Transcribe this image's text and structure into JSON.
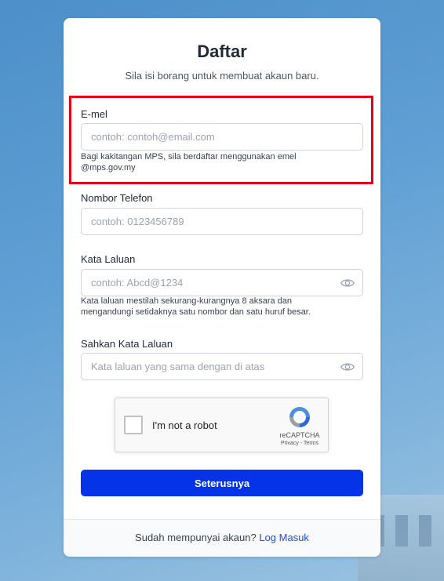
{
  "form": {
    "title": "Daftar",
    "subtitle": "Sila isi borang untuk membuat akaun baru.",
    "email": {
      "label": "E-mel",
      "placeholder": "contoh: contoh@email.com",
      "hint": "Bagi kakitangan MPS, sila berdaftar menggunakan emel @mps.gov.my"
    },
    "phone": {
      "label": "Nombor Telefon",
      "placeholder": "contoh: 0123456789"
    },
    "password": {
      "label": "Kata Laluan",
      "placeholder": "contoh: Abcd@1234",
      "hint": "Kata laluan mestilah sekurang-kurangnya 8 aksara dan mengandungi setidaknya satu nombor dan satu huruf besar.",
      "toggle_icon": "eye-icon"
    },
    "confirm_password": {
      "label": "Sahkan Kata Laluan",
      "placeholder": "Kata laluan yang sama dengan di atas",
      "toggle_icon": "eye-icon"
    },
    "recaptcha": {
      "label": "I'm not a robot",
      "brand": "reCAPTCHA",
      "privacy": "Privacy",
      "separator": " - ",
      "terms": "Terms"
    },
    "submit_label": "Seterusnya"
  },
  "footer": {
    "text": "Sudah mempunyai akaun?",
    "link": "Log Masuk"
  },
  "colors": {
    "primary_button": "#0533e8",
    "highlight_border": "#e0001a",
    "link": "#1d4ed8"
  }
}
